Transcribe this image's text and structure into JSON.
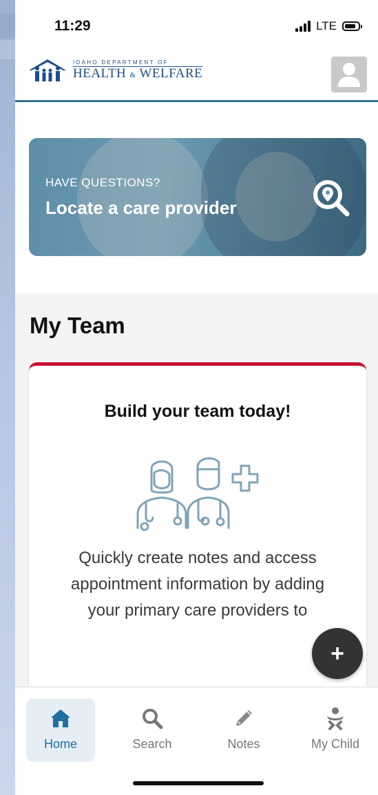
{
  "status_bar": {
    "time": "11:29",
    "network": "LTE"
  },
  "header": {
    "logo_small": "IDAHO DEPARTMENT OF",
    "logo_health": "HEALTH",
    "logo_amp": "&",
    "logo_welfare": "WELFARE",
    "profile_icon": "user-icon"
  },
  "banner": {
    "eyebrow": "HAVE QUESTIONS?",
    "title": "Locate a care provider",
    "icon": "location-search-icon"
  },
  "team": {
    "title": "My Team",
    "card_title": "Build your team today!",
    "card_body": "Quickly create notes and access appointment information by adding your primary care providers to",
    "illustration": "doctors-icon",
    "accent_color": "#c8102e"
  },
  "fab": {
    "label": "+"
  },
  "bottom_nav": {
    "items": [
      {
        "label": "Home",
        "icon": "home-icon",
        "active": true
      },
      {
        "label": "Search",
        "icon": "search-icon",
        "active": false
      },
      {
        "label": "Notes",
        "icon": "pencil-icon",
        "active": false
      },
      {
        "label": "My Child",
        "icon": "child-icon",
        "active": false
      }
    ],
    "active_color": "#1f6fa5"
  }
}
